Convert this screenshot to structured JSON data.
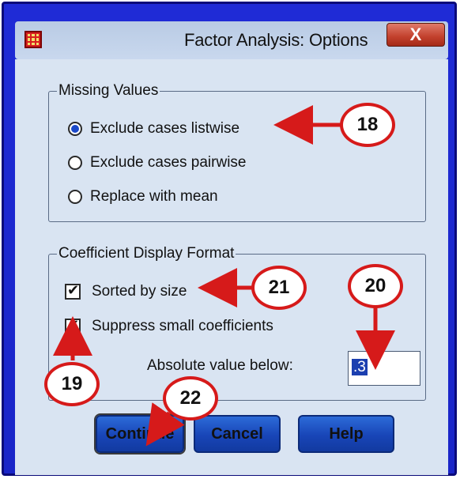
{
  "window": {
    "title": "Factor Analysis: Options",
    "close_label": "X"
  },
  "missing_values": {
    "legend": "Missing Values",
    "options": [
      {
        "label": "Exclude cases listwise",
        "selected": true
      },
      {
        "label": "Exclude cases pairwise",
        "selected": false
      },
      {
        "label": "Replace with mean",
        "selected": false
      }
    ]
  },
  "coefficient_display": {
    "legend": "Coefficient Display Format",
    "sorted_by_size": {
      "label": "Sorted by size",
      "checked": true
    },
    "suppress_small": {
      "label": "Suppress small coefficients",
      "checked": true
    },
    "absolute_label": "Absolute value below:",
    "absolute_value": ".3"
  },
  "buttons": {
    "continue": "Continue",
    "cancel": "Cancel",
    "help": "Help"
  },
  "callouts": {
    "c18": "18",
    "c19": "19",
    "c20": "20",
    "c21": "21",
    "c22": "22"
  },
  "colors": {
    "frame": "#1f2bd6",
    "client": "#d9e4f2",
    "callout_border": "#d61a1a",
    "button": "#1845b7"
  }
}
